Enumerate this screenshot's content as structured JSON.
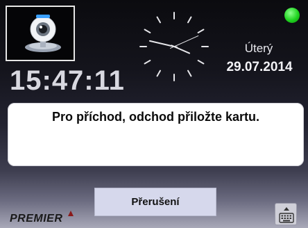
{
  "header": {
    "weekday": "Úterý",
    "date": "29.07.2014",
    "time": "15:47:11",
    "status_color": "#1fd41f"
  },
  "clock": {
    "hours": 15,
    "minutes": 47,
    "seconds": 11
  },
  "camera": {
    "icon": "webcam-icon"
  },
  "message": {
    "text": "Pro příchod, odchod přiložte kartu."
  },
  "actions": {
    "cancel_label": "Přerušení",
    "keyboard_icon": "keyboard-icon"
  },
  "footer": {
    "logo_text": "PREMIER"
  }
}
